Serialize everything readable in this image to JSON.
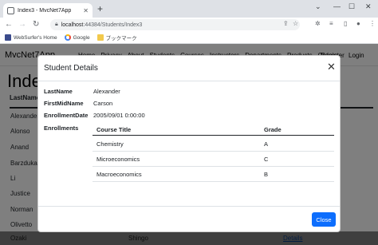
{
  "browser": {
    "tab_title": "Index3 - MvcNet7App",
    "url_host": "localhost",
    "url_path": ":44384/Students/Index3",
    "bookmarks": [
      "WebSurfer's Home",
      "Google",
      "ブックマーク"
    ]
  },
  "app": {
    "brand": "MvcNet7App",
    "nav": [
      "Home",
      "Privacy",
      "About",
      "Students",
      "Courses",
      "Instructors",
      "Departments",
      "Products",
      "Orders"
    ],
    "nav_right": [
      "Register",
      "Login"
    ],
    "page_title": "Index3",
    "table_header": "LastName",
    "rows": [
      "Alexander",
      "Alonso",
      "Anand",
      "Barzdukas",
      "Li",
      "Justice",
      "Norman",
      "Olivetto",
      "Ozaki"
    ],
    "bottom_row": {
      "last": "Ozaki",
      "first": "Shingo",
      "link": "Details"
    }
  },
  "modal": {
    "title": "Student Details",
    "fields": [
      {
        "label": "LastName",
        "value": "Alexander"
      },
      {
        "label": "FirstMidName",
        "value": "Carson"
      },
      {
        "label": "EnrollmentDate",
        "value": "2005/09/01 0:00:00"
      }
    ],
    "enrollments_label": "Enrollments",
    "enrollments": {
      "headers": [
        "Course Title",
        "Grade"
      ],
      "rows": [
        {
          "title": "Chemistry",
          "grade": "A"
        },
        {
          "title": "Microeconomics",
          "grade": "C"
        },
        {
          "title": "Macroeconomics",
          "grade": "B"
        }
      ]
    },
    "close_label": "Close"
  }
}
